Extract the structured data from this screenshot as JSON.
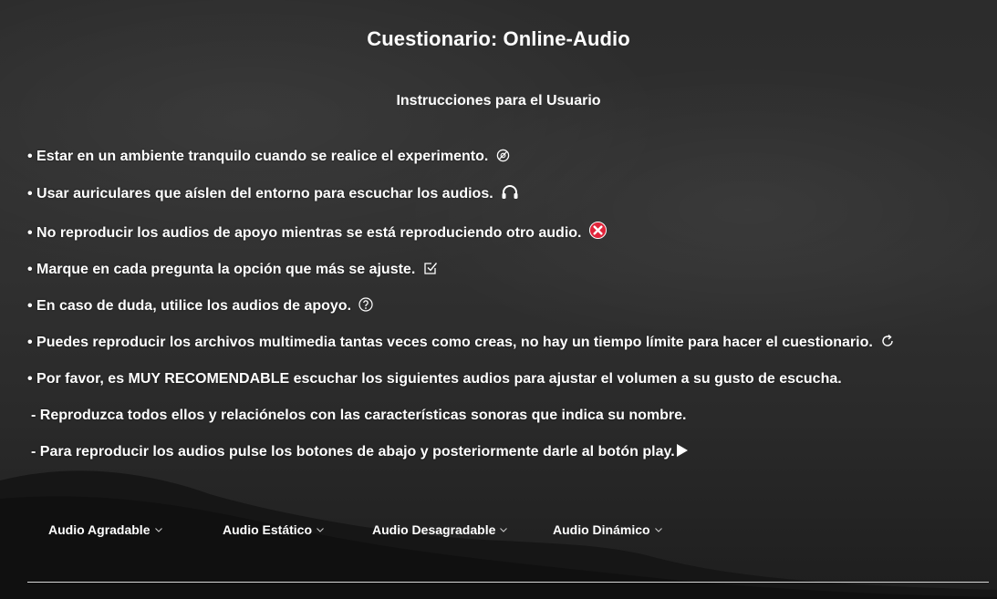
{
  "page": {
    "title": "Cuestionario: Online-Audio",
    "subtitle": "Instrucciones para el Usuario"
  },
  "instructions": [
    {
      "text": "• Estar en un ambiente tranquilo cuando se realice el experimento.",
      "icon": "no-sound-icon"
    },
    {
      "text": "• Usar auriculares que aíslen del entorno para escuchar los audios.",
      "icon": "headphones-icon"
    },
    {
      "text": "• No reproducir los audios de apoyo mientras se está reproduciendo otro audio.",
      "icon": "red-x-icon"
    },
    {
      "text": "• Marque en cada pregunta la opción que más se ajuste.",
      "icon": "checkbox-icon"
    },
    {
      "text": "• En caso de duda, utilice los audios de apoyo.",
      "icon": "question-icon"
    },
    {
      "text": "• Puedes reproducir los archivos multimedia tantas veces como creas, no hay un tiempo límite para hacer el cuestionario.",
      "icon": "repeat-icon"
    },
    {
      "text": "• Por favor, es MUY RECOMENDABLE escuchar los siguientes audios para ajustar el volumen a su gusto de escucha."
    },
    {
      "text": " - Reproduzca todos ellos y relaciónelos con las características sonoras que indica su nombre."
    },
    {
      "text": " - Para reproducir los audios pulse los botones de abajo y posteriormente darle al botón play.",
      "icon": "play-icon"
    }
  ],
  "menu": [
    {
      "label": "Audio Agradable"
    },
    {
      "label": "Audio Estático"
    },
    {
      "label": "Audio Desagradable"
    },
    {
      "label": "Audio Dinámico"
    }
  ],
  "colors": {
    "text": "#ffffff",
    "accent_red": "#e0243a",
    "divider": "#d8d8d8"
  }
}
